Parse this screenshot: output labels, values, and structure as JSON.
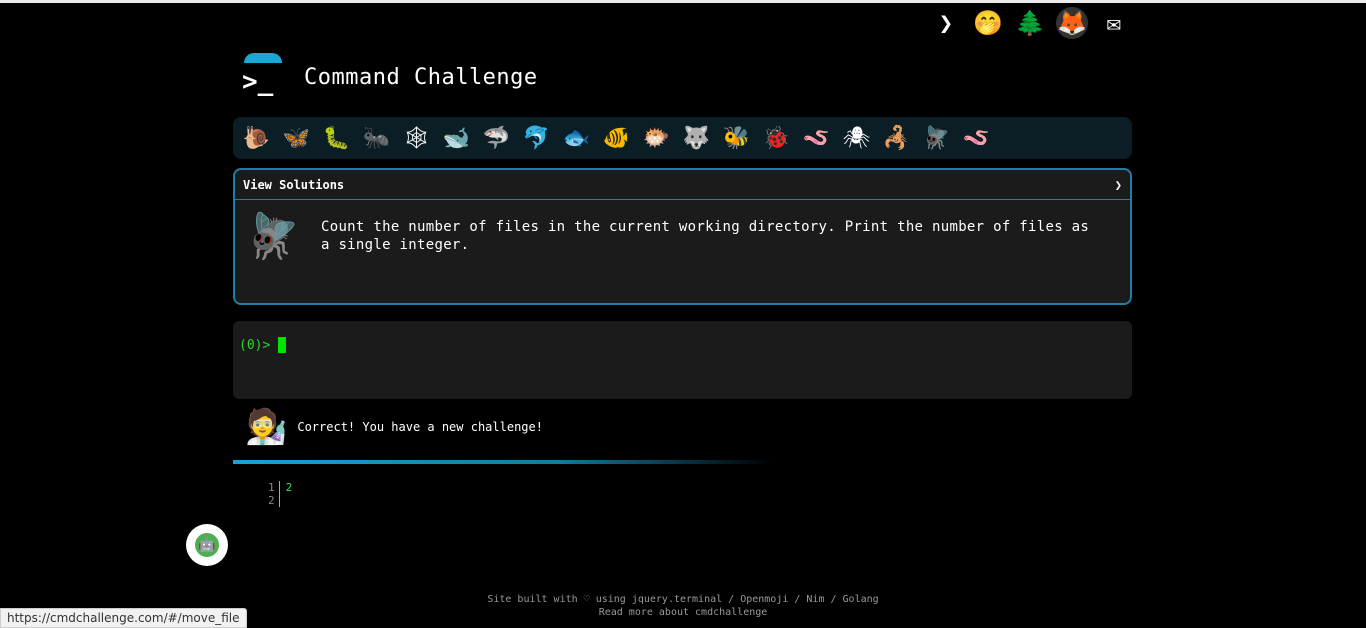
{
  "top_icons": [
    {
      "name": "terminal-icon",
      "glyph": "❯"
    },
    {
      "name": "face-icon",
      "glyph": "🤭"
    },
    {
      "name": "tree-icon",
      "glyph": "🌲"
    },
    {
      "name": "gitlab-icon",
      "glyph": "🦊"
    },
    {
      "name": "mail-icon",
      "glyph": "✉"
    }
  ],
  "header": {
    "title": "Command Challenge",
    "logo_prompt": ">_"
  },
  "animals": [
    "🐌",
    "🦋",
    "🐛",
    "🐜",
    "🕸",
    "🐋",
    "🦈",
    "🐬",
    "🐟",
    "🐠",
    "🐡",
    "🐺",
    "🐝",
    "🐞",
    "🪱",
    "🕷",
    "🦂",
    "🪰",
    "🪱"
  ],
  "challenge": {
    "header_label": "View Solutions",
    "header_arrow": "❯",
    "icon": "🪰",
    "text": "Count the number of files in the current working directory. Print the number of files as a single integer."
  },
  "terminal": {
    "prompt": "(0)>"
  },
  "status": {
    "icon": "🧑‍🔬",
    "message": "Correct! You have a new challenge!"
  },
  "output": {
    "gutter": [
      "1",
      "2"
    ],
    "lines": [
      "2",
      ""
    ]
  },
  "footer": {
    "line1": "Site built with ♡ using jquery.terminal / Openmoji / Nim / Golang",
    "line2": "Read more about cmdchallenge"
  },
  "statusbar": {
    "url": "https://cmdchallenge.com/#/move_file"
  },
  "chat": {
    "glyph": "🤖"
  }
}
